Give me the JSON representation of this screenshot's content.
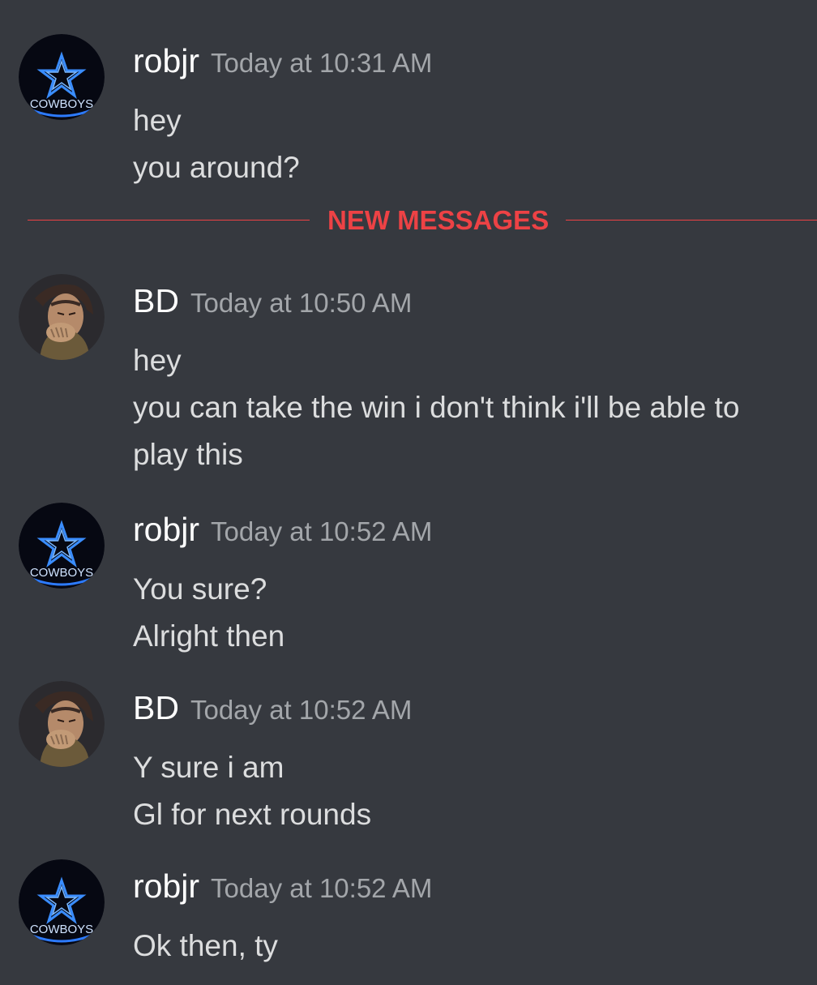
{
  "divider": {
    "label": "NEW MESSAGES",
    "color": "#ed4245"
  },
  "colors": {
    "background": "#36393f",
    "username": "#ffffff",
    "text": "#dcddde",
    "timestamp": "#a3a6aa"
  },
  "messages": [
    {
      "author": "robjr",
      "avatar": "cowboys-star-icon",
      "avatar_text": "COWBOYS",
      "timestamp": "Today at 10:31 AM",
      "lines": [
        "hey",
        "you around?"
      ]
    },
    {
      "author": "BD",
      "avatar": "anime-character-avatar",
      "timestamp": "Today at 10:50 AM",
      "lines": [
        "hey",
        "you can take the win i don't think i'll be able to",
        "play this"
      ]
    },
    {
      "author": "robjr",
      "avatar": "cowboys-star-icon",
      "avatar_text": "COWBOYS",
      "timestamp": "Today at 10:52 AM",
      "lines": [
        "You sure?",
        "Alright then"
      ]
    },
    {
      "author": "BD",
      "avatar": "anime-character-avatar",
      "timestamp": "Today at 10:52 AM",
      "lines": [
        "Y sure i am",
        "Gl for next rounds"
      ]
    },
    {
      "author": "robjr",
      "avatar": "cowboys-star-icon",
      "avatar_text": "COWBOYS",
      "timestamp": "Today at 10:52 AM",
      "lines": [
        "Ok then, ty"
      ]
    }
  ]
}
